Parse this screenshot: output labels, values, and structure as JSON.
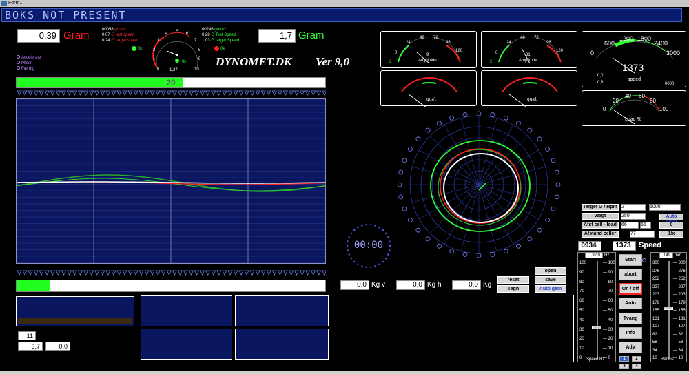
{
  "window": {
    "title": "Form1"
  },
  "banner": {
    "text": "BOKS NOT PRESENT"
  },
  "left_readout": {
    "value": "0,39",
    "unit": "Gram"
  },
  "right_readout": {
    "value": "1,7",
    "unit": "Gram"
  },
  "left_stats": {
    "line1_num": "00058",
    "line1_label": "gmm2",
    "line2_num": "0,07",
    "line2_label": "G test speed",
    "line3_num": "0,24",
    "line3_label": "G target speed",
    "ok": "0k"
  },
  "right_stats": {
    "line1_num": "00246",
    "line1_label": "gmm2",
    "line2_num": "0,28",
    "line2_label": "G Test Speed",
    "line3_num": "1,03",
    "line3_label": "G target Speed",
    "ok": "0k"
  },
  "center_gauge": {
    "value_text": "1,27",
    "ok": "0k",
    "ticks": [
      "0",
      "1",
      "2",
      "3",
      "4",
      "5",
      "6",
      "7",
      "8",
      "9",
      "10"
    ]
  },
  "legend": {
    "items": [
      "Accelerate",
      "Måler",
      "Færdig"
    ]
  },
  "brand": {
    "name": "DYNOMET.DK",
    "version": "Ver 9,0"
  },
  "progress_top": {
    "value": 0.54,
    "label": "20"
  },
  "progress_bottom": {
    "value": 0.11
  },
  "amp_gauge_1": {
    "label": "Amplitude",
    "value": "9",
    "left": "2",
    "ticks": [
      "0",
      "24",
      "48",
      "72",
      "96",
      "120"
    ]
  },
  "amp_gauge_2": {
    "label": "Amplitude",
    "value": "31",
    "left": "2",
    "ticks": [
      "0",
      "24",
      "48",
      "72",
      "96",
      "120"
    ]
  },
  "qual_gauge_1": {
    "label": "qual"
  },
  "qual_gauge_2": {
    "label": "qual"
  },
  "speed_gauge": {
    "label": "speed",
    "value": "1373",
    "ticks": [
      "0",
      "600",
      "1200",
      "1800",
      "2400",
      "3000"
    ],
    "small1": "0,0",
    "small2": "0,8",
    "small3": "0000"
  },
  "load_gauge": {
    "label": "Load %",
    "ticks": [
      "0",
      "20",
      "40",
      "60",
      "80",
      "100"
    ]
  },
  "timer": {
    "text": "00:00"
  },
  "kg": {
    "kgv_value": "0,0",
    "kgv_unit": "Kg v",
    "kgh_value": "0,0",
    "kgh_unit": "Kg h",
    "kg_value": "0,0",
    "kg_unit": "Kg"
  },
  "mid_buttons": {
    "reset": "reset",
    "tegn": "Tegn",
    "open": "open",
    "save": "save",
    "auto_gem": "Auto gem"
  },
  "settings": {
    "target_label": "Target G / Rpm",
    "target_g": "2",
    "target_rpm": "5000",
    "vaegt_label": "vægt",
    "vaegt_value": "250",
    "auto_vaegt": "Auto vægt",
    "afst_label": "Afst cell - load",
    "afst_v1": "66",
    "afst_v2": "66",
    "afst_btn": "0",
    "afstand_label": "Afstand celler",
    "afstand_value": "77",
    "inv_btn": "1/x"
  },
  "speed_display": {
    "rpm_left": "0934",
    "rpm_right": "1373",
    "label": "Speed"
  },
  "hz_slider": {
    "value": "32,0",
    "unit": "Hz",
    "caption": "Speed Hz",
    "level": 0.32,
    "ticks": [
      "100",
      "90",
      "80",
      "70",
      "60",
      "50",
      "40",
      "30",
      "20",
      "10",
      "0"
    ]
  },
  "radius_slider": {
    "value": "149",
    "unit": "mm",
    "caption": "Radius",
    "level": 0.52,
    "ticks": [
      "300",
      "276",
      "252",
      "227",
      "203",
      "179",
      "155",
      "131",
      "107",
      "82",
      "58",
      "34",
      "10"
    ]
  },
  "side_buttons": {
    "start": "Start",
    "abort": "abort",
    "onoff": "On / off",
    "auto": "Auto",
    "tvang": "Tvang",
    "info": "Info",
    "adv": "Adv setup",
    "p1": "1",
    "p2": "2",
    "p3": "3",
    "p4": "4"
  },
  "bottom_left": {
    "v1": "11",
    "v2": "3,7",
    "v3": "0,0"
  },
  "colors": {
    "green": "#30ff30",
    "red": "#ff2020",
    "blue_bg": "#0a1660",
    "banner": "#0a1a6e"
  }
}
